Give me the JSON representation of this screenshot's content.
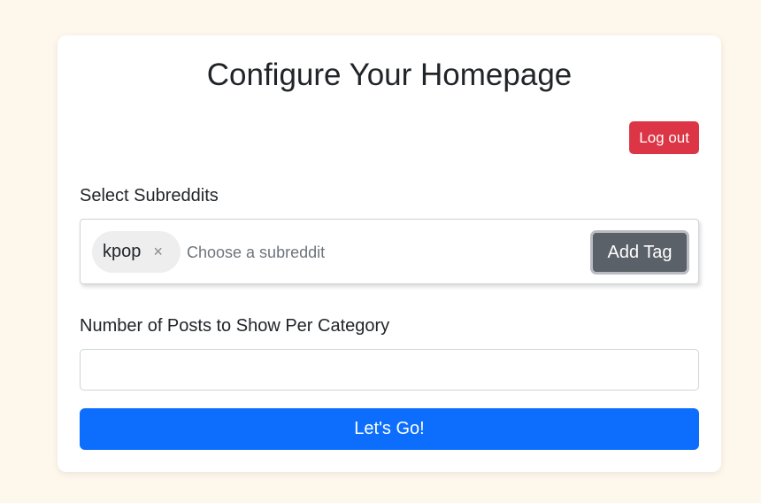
{
  "page": {
    "title": "Configure Your Homepage",
    "background": "#fef7ec"
  },
  "header": {
    "logout_label": "Log out",
    "logout_color": "#dc3545"
  },
  "subreddits": {
    "label": "Select Subreddits",
    "tags": [
      {
        "label": "kpop",
        "remove_glyph": "×"
      }
    ],
    "input_placeholder": "Choose a subreddit",
    "input_value": "",
    "add_tag_label": "Add Tag"
  },
  "posts": {
    "label": "Number of Posts to Show Per Category",
    "input_value": "",
    "input_placeholder": ""
  },
  "submit": {
    "label": "Let's Go!",
    "color": "#0d6efd"
  }
}
